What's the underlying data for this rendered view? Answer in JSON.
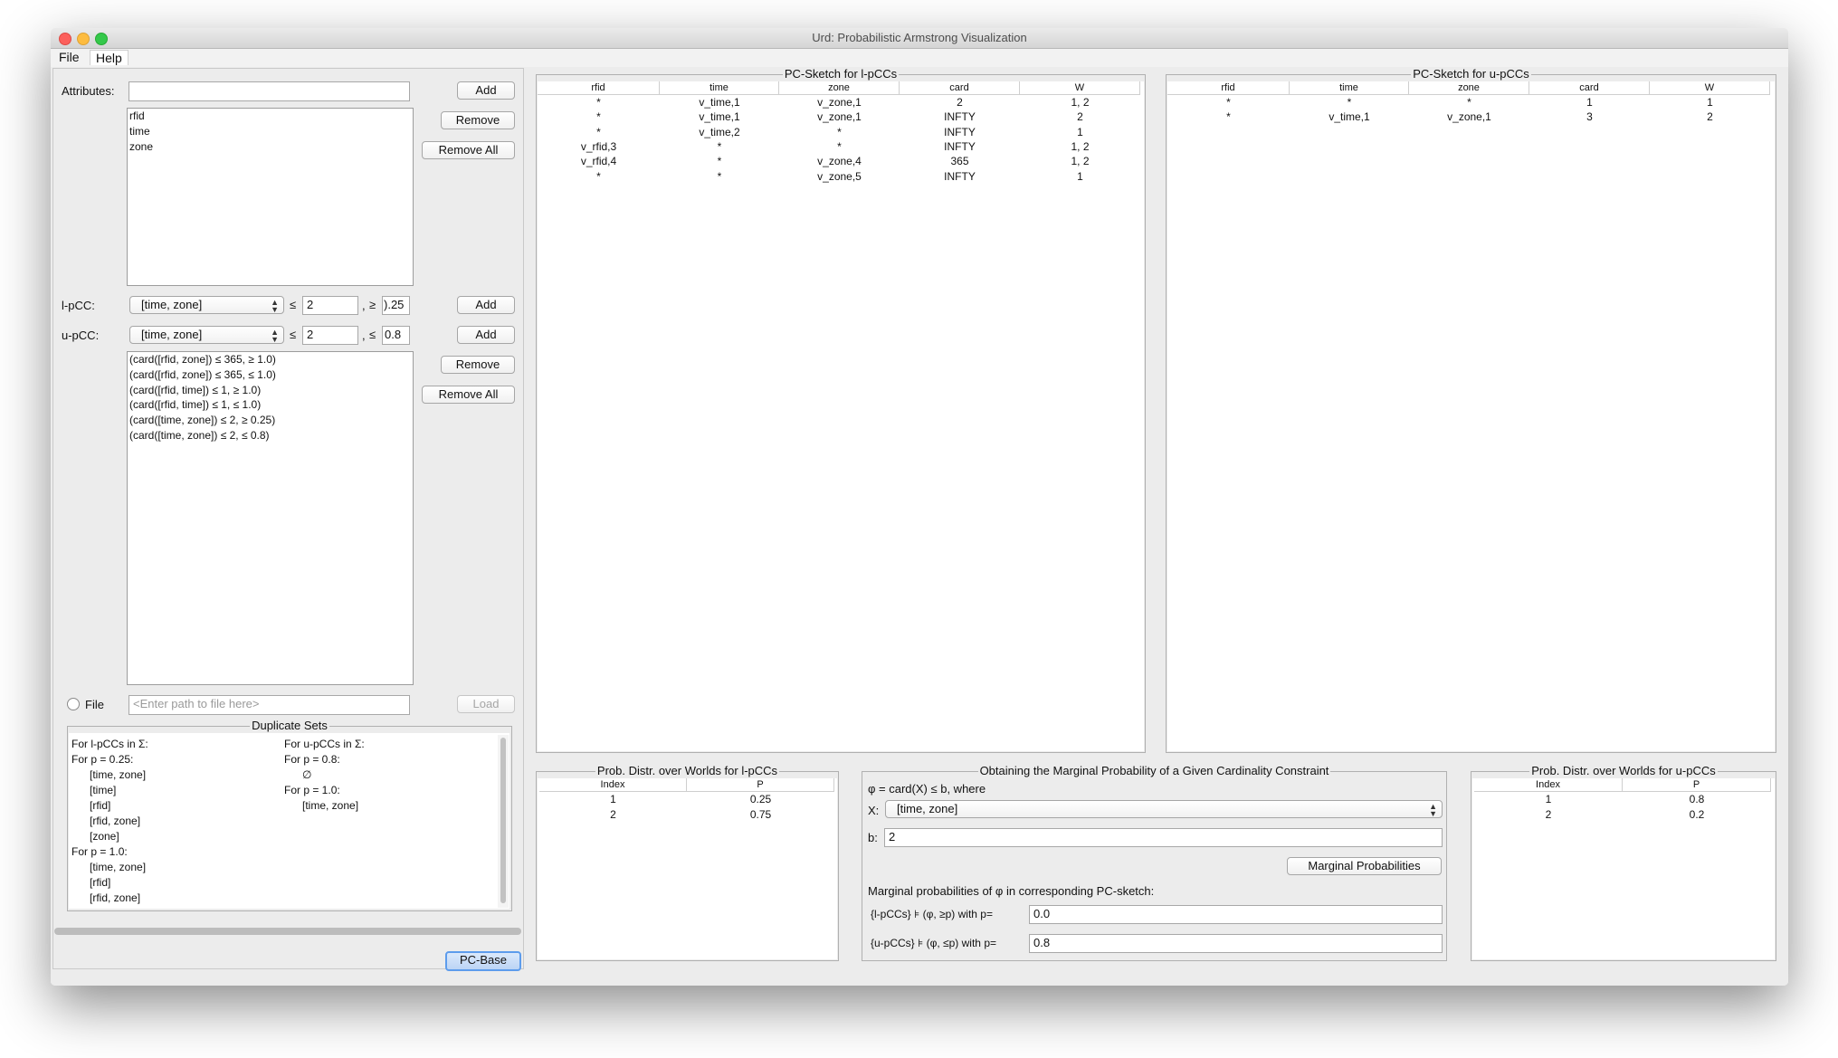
{
  "window": {
    "title": "Urd: Probabilistic Armstrong Visualization"
  },
  "menubar": {
    "file": "File",
    "help": "Help"
  },
  "left": {
    "attributes_label": "Attributes:",
    "attributes_value": "",
    "add_label": "Add",
    "remove_label": "Remove",
    "remove_all_label": "Remove All",
    "attributes_list": [
      "rfid",
      "time",
      "zone"
    ],
    "lpcc": {
      "label": "l-pCC:",
      "selected": "[time, zone]",
      "le": "≤",
      "b_value": "2",
      "sep": ",",
      "ge": "≥",
      "p_value": ").25",
      "add_label": "Add"
    },
    "upcc": {
      "label": "u-pCC:",
      "selected": "[time, zone]",
      "le": "≤",
      "b_value": "2",
      "sep": ",",
      "le2": "≤",
      "p_value": "0.8",
      "add_label": "Add"
    },
    "constraints_remove_label": "Remove",
    "constraints_remove_all_label": "Remove All",
    "constraints": [
      "(card([rfid, zone]) ≤ 365,  ≥ 1.0)",
      "(card([rfid, zone]) ≤ 365,  ≤ 1.0)",
      "(card([rfid, time]) ≤ 1,  ≥ 1.0)",
      "(card([rfid, time]) ≤ 1,  ≤ 1.0)",
      "(card([time, zone]) ≤ 2,  ≥ 0.25)",
      "(card([time, zone]) ≤ 2,  ≤ 0.8)"
    ],
    "file_label": "File",
    "file_placeholder": "<Enter path to file here>",
    "load_label": "Load",
    "duplicate": {
      "title": "Duplicate Sets",
      "left_lines": [
        "For l-pCCs in Σ:",
        "For p = 0.25:",
        "[time, zone]",
        "[time]",
        "[rfid]",
        "[rfid, zone]",
        "[zone]",
        "For p = 1.0:",
        "[time, zone]",
        "[rfid]",
        "[rfid, zone]"
      ],
      "right_lines": [
        "For u-pCCs in Σ:",
        "For p = 0.8:",
        "∅",
        "For p = 1.0:",
        "[time, zone]"
      ]
    },
    "pcbase_label": "PC-Base"
  },
  "sketch_l": {
    "title": "PC-Sketch for l-pCCs",
    "columns": [
      "rfid",
      "time",
      "zone",
      "card",
      "W"
    ],
    "rows": [
      [
        "*",
        "v_time,1",
        "v_zone,1",
        "2",
        "1, 2"
      ],
      [
        "*",
        "v_time,1",
        "v_zone,1",
        "INFTY",
        "2"
      ],
      [
        "*",
        "v_time,2",
        "*",
        "INFTY",
        "1"
      ],
      [
        "v_rfid,3",
        "*",
        "*",
        "INFTY",
        "1, 2"
      ],
      [
        "v_rfid,4",
        "*",
        "v_zone,4",
        "365",
        "1, 2"
      ],
      [
        "*",
        "*",
        "v_zone,5",
        "INFTY",
        "1"
      ]
    ]
  },
  "sketch_u": {
    "title": "PC-Sketch for u-pCCs",
    "columns": [
      "rfid",
      "time",
      "zone",
      "card",
      "W"
    ],
    "rows": [
      [
        "*",
        "*",
        "*",
        "1",
        "1"
      ],
      [
        "*",
        "v_time,1",
        "v_zone,1",
        "3",
        "2"
      ]
    ]
  },
  "prob_l": {
    "title": "Prob. Distr. over Worlds for l-pCCs",
    "columns": [
      "Index",
      "P"
    ],
    "rows": [
      [
        "1",
        "0.25"
      ],
      [
        "2",
        "0.75"
      ]
    ]
  },
  "prob_u": {
    "title": "Prob. Distr. over Worlds for u-pCCs",
    "columns": [
      "Index",
      "P"
    ],
    "rows": [
      [
        "1",
        "0.8"
      ],
      [
        "2",
        "0.2"
      ]
    ]
  },
  "marginal": {
    "title": "Obtaining the Marginal Probability of a Given Cardinality Constraint",
    "phi_line": "φ = card(X) ≤ b, where",
    "x_label": "X:",
    "x_selected": "[time, zone]",
    "b_label": "b:",
    "b_value": "2",
    "button": "Marginal Probabilities",
    "result_caption": "Marginal probabilities of φ in corresponding PC-sketch:",
    "l_label": "{l-pCCs} ⊧ (φ, ≥p)  with p=",
    "l_value": "0.0",
    "u_label": "{u-pCCs} ⊧ (φ, ≤p) with p=",
    "u_value": "0.8"
  }
}
